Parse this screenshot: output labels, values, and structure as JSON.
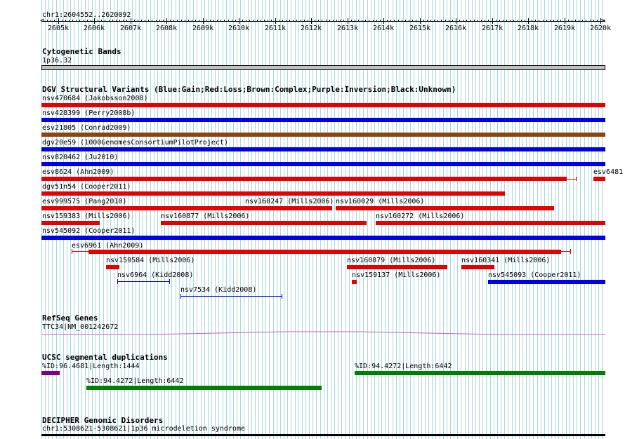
{
  "ruler": {
    "position": "chr1:2604552..2620092",
    "ticks": [
      "2605k",
      "2606k",
      "2607k",
      "2608k",
      "2609k",
      "2610k",
      "2611k",
      "2612k",
      "2613k",
      "2614k",
      "2615k",
      "2616k",
      "2617k",
      "2618k",
      "2619k",
      "2620k"
    ]
  },
  "tracks": {
    "cytoband": {
      "title": "Cytogenetic Bands",
      "band": "1p36.32"
    },
    "dgv": {
      "title": "DGV Structural Variants (Blue:Gain;Red:Loss;Brown:Complex;Purple:Inversion;Black:Unknown)",
      "features": [
        "nsv470684 (Jakobsson2008)",
        "nsv428399 (Perry2008b)",
        "esv21805 (Conrad2009)",
        "dgv20e59 (1000GenomesConsortiumPilotProject)",
        "nsv820462 (Ju2010)",
        "esv8624 (Ahn2009)",
        "esv6481",
        "dgv51n54 (Cooper2011)",
        "esv999575 (Pang2010)",
        "nsv160247 (Mills2006)",
        "nsv160029 (Mills2006)",
        "nsv159383 (Mills2006)",
        "nsv160877 (Mills2006)",
        "nsv160272 (Mills2006)",
        "nsv545092 (Cooper2011)",
        "esv6961 (Ahn2009)",
        "nsv159584 (Mills2006)",
        "nsv160879 (Mills2006)",
        "nsv160341 (Mills2006)",
        "nsv6964 (Kidd2008)",
        "nsv159137 (Mills2006)",
        "nsv545093 (Cooper2011)",
        "nsv7534 (Kidd2008)"
      ]
    },
    "refseq": {
      "title": "RefSeq Genes",
      "gene": "TTC34|NM_001242672"
    },
    "segdup": {
      "title": "UCSC segmental duplications",
      "features": [
        "%ID:96.4681|Length:1444",
        "%ID:94.4272|Length:6442",
        "%ID:94.4272|Length:6442"
      ]
    },
    "decipher": {
      "title": "DECIPHER Genomic Disorders",
      "feature": "chr1:5308621-5308621|1p36 microdeletion syndrome"
    }
  },
  "colors": {
    "gain": "#0000e6",
    "loss": "#e60000",
    "complex": "#8b4513",
    "inversion": "#800080",
    "segdup_purple": "#800080",
    "segdup_green": "#008000",
    "gene": "#c060c0",
    "grid": "#a8d8e0",
    "cytoband": "#c0c0c0"
  }
}
